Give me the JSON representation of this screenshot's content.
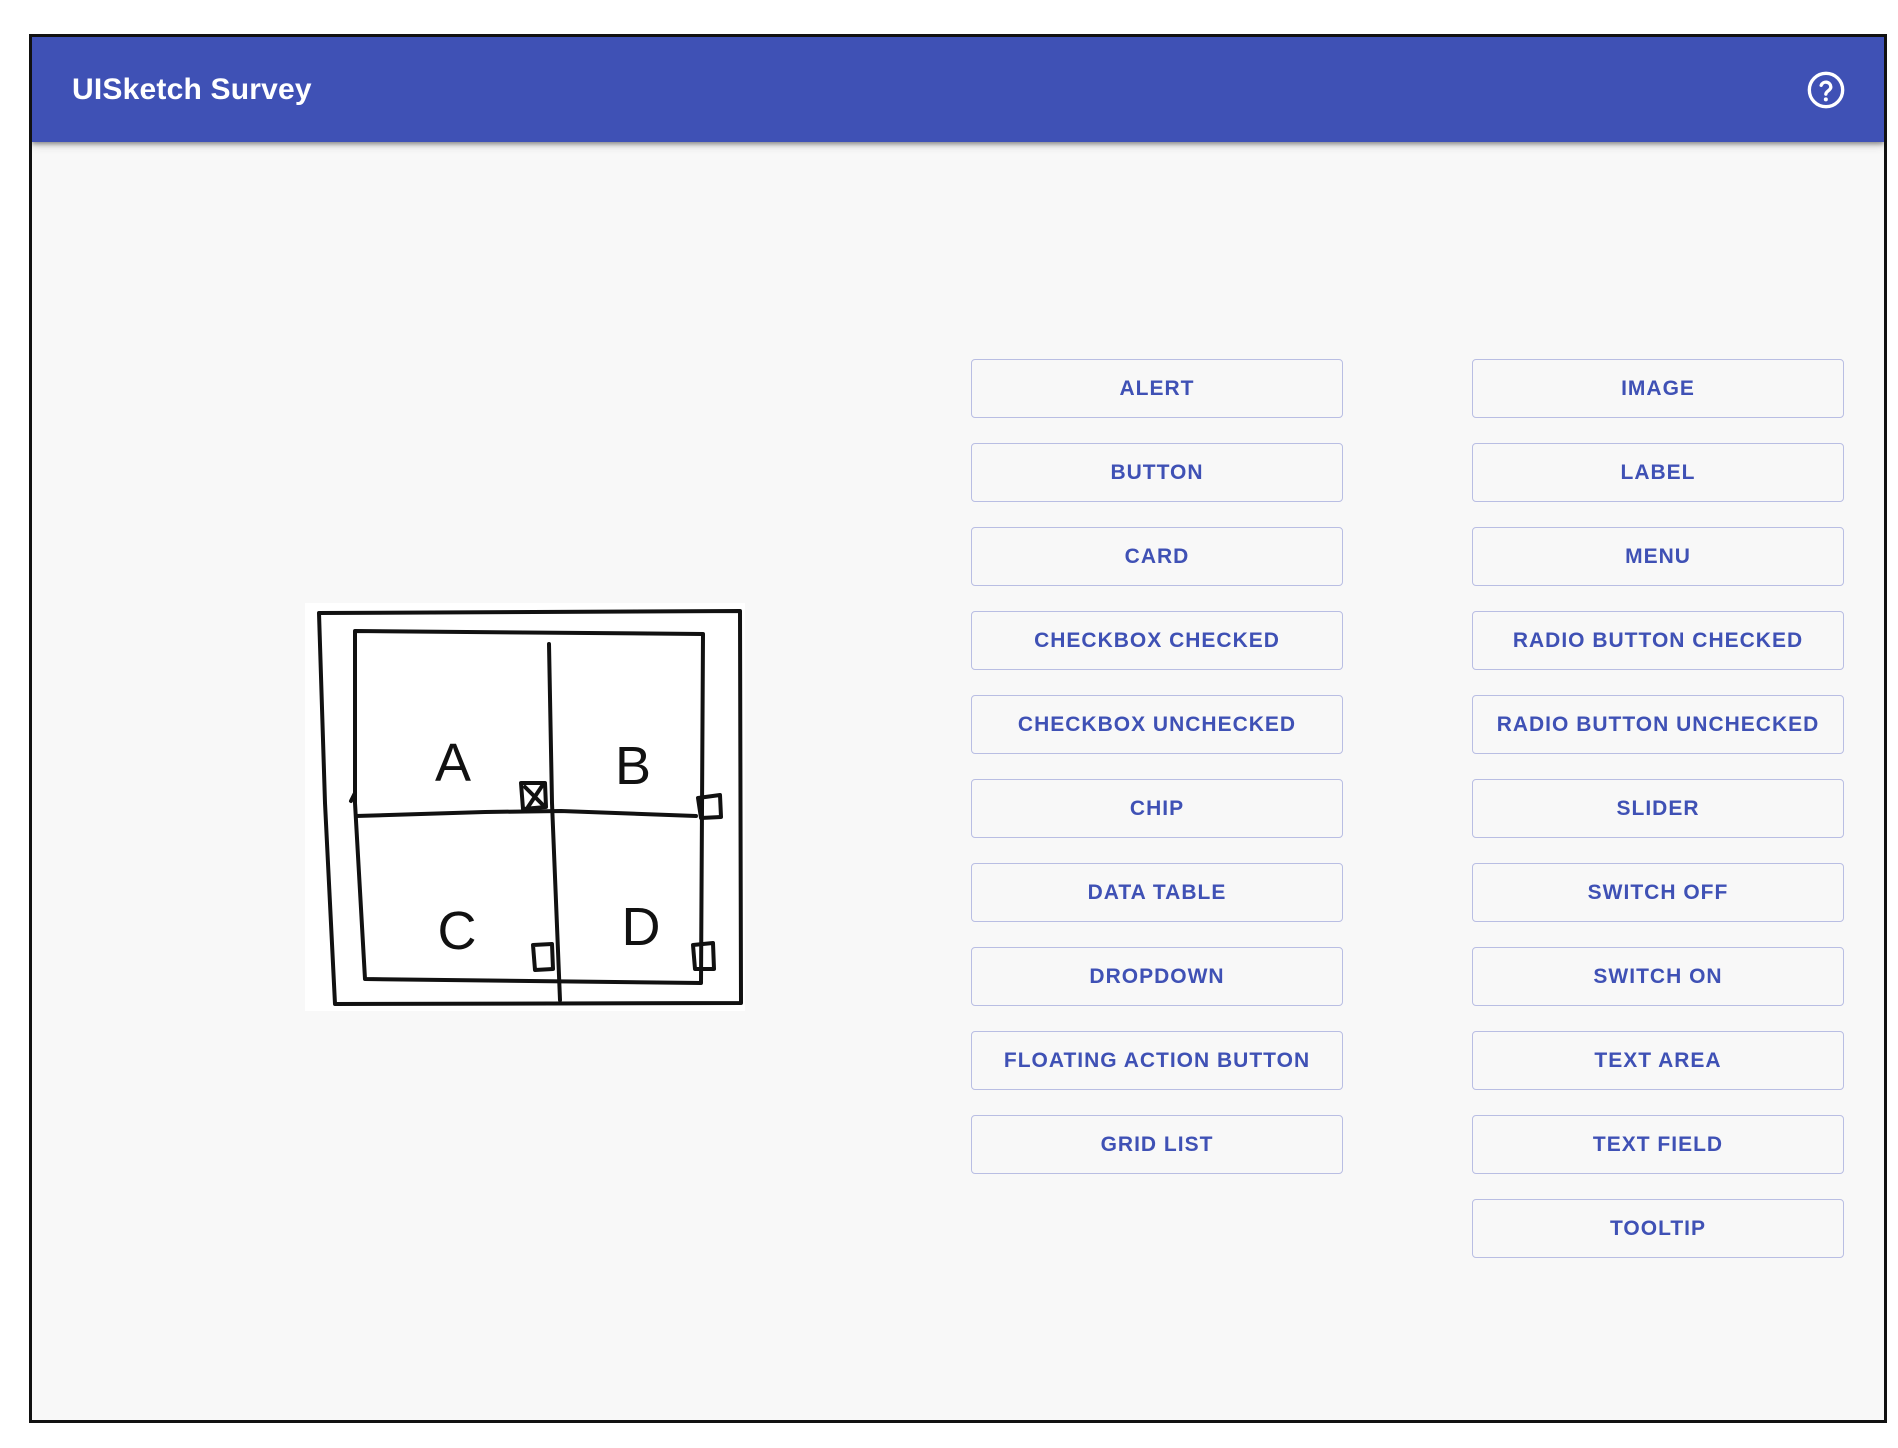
{
  "app": {
    "title": "UISketch Survey",
    "help_icon": "help-circle-outline-icon",
    "primary_color": "#3f51b5"
  },
  "sketch": {
    "cell_labels": [
      "A",
      "B",
      "C",
      "D"
    ]
  },
  "options": {
    "left": [
      "ALERT",
      "BUTTON",
      "CARD",
      "CHECKBOX CHECKED",
      "CHECKBOX UNCHECKED",
      "CHIP",
      "DATA TABLE",
      "DROPDOWN",
      "FLOATING ACTION BUTTON",
      "GRID LIST"
    ],
    "right": [
      "IMAGE",
      "LABEL",
      "MENU",
      "RADIO BUTTON CHECKED",
      "RADIO BUTTON UNCHECKED",
      "SLIDER",
      "SWITCH OFF",
      "SWITCH ON",
      "TEXT AREA",
      "TEXT FIELD",
      "TOOLTIP"
    ]
  }
}
